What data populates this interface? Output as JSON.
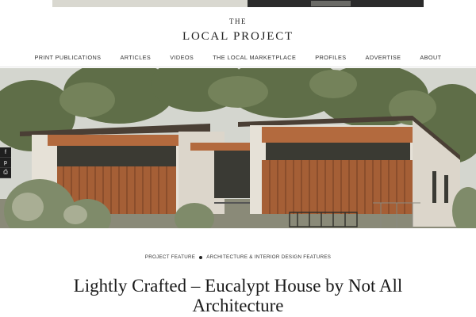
{
  "banner": {
    "icon": "ad-banner"
  },
  "logo": {
    "the": "THE",
    "name": "LOCAL PROJECT"
  },
  "nav": {
    "items": [
      "PRINT PUBLICATIONS",
      "ARTICLES",
      "VIDEOS",
      "THE LOCAL MARKETPLACE",
      "PROFILES",
      "ADVERTISE",
      "ABOUT"
    ]
  },
  "share": {
    "facebook": "f",
    "pinterest": "p",
    "print": "⎙"
  },
  "categories": {
    "first": "PROJECT FEATURE",
    "second": "ARCHITECTURE & INTERIOR DESIGN FEATURES"
  },
  "article": {
    "title": "Lightly Crafted – Eucalypt House by Not All Architecture"
  },
  "colors": {
    "cladding": "#b36a3e",
    "render": "#e6e1d7",
    "foliage": "#5e6e4a",
    "sky": "#d6d8d2"
  }
}
